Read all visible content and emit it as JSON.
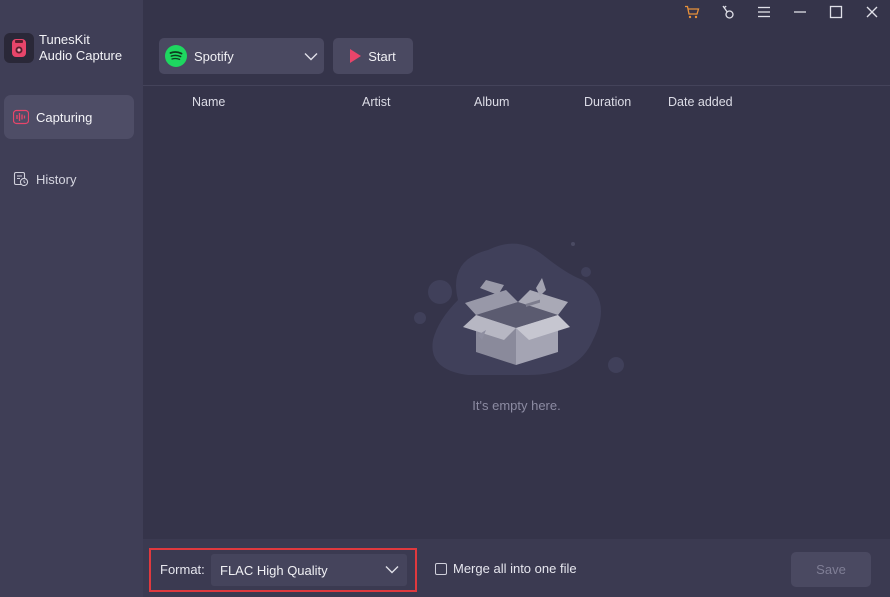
{
  "app": {
    "name_line1": "TunesKit",
    "name_line2": "Audio Capture"
  },
  "sidebar": {
    "items": [
      {
        "label": "Capturing",
        "icon": "waveform-icon",
        "active": true
      },
      {
        "label": "History",
        "icon": "history-icon",
        "active": false
      }
    ]
  },
  "titlebar": {
    "icons": [
      "cart-icon",
      "key-icon",
      "menu-icon",
      "minimize-icon",
      "maximize-icon",
      "close-icon"
    ],
    "accent": "#e8913a"
  },
  "toolbar": {
    "source_label": "Spotify",
    "start_label": "Start"
  },
  "table": {
    "columns": [
      "Name",
      "Artist",
      "Album",
      "Duration",
      "Date added"
    ]
  },
  "empty_state": {
    "text": "It's empty here."
  },
  "footer": {
    "format_label": "Format:",
    "format_value": "FLAC High Quality",
    "merge_label": "Merge all into one file",
    "merge_checked": false,
    "save_label": "Save"
  },
  "colors": {
    "brand": "#e8456a",
    "highlight": "#e0393e",
    "spotify": "#1ed760"
  }
}
